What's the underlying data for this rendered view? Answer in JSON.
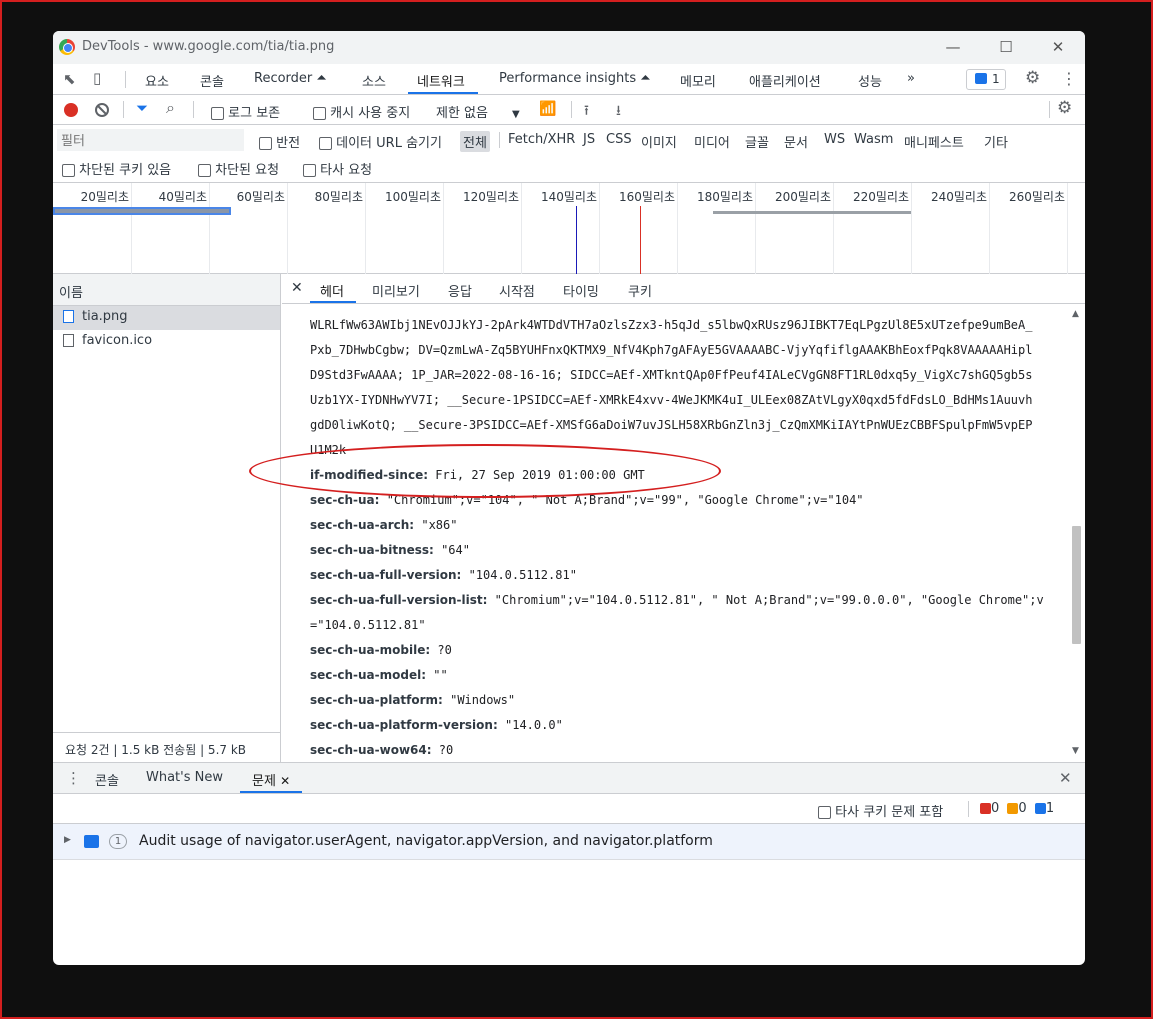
{
  "window": {
    "title": "DevTools - www.google.com/tia/tia.png"
  },
  "main_tabs": [
    {
      "label": "요소"
    },
    {
      "label": "콘솔"
    },
    {
      "label": "Recorder ⏶"
    },
    {
      "label": "소스"
    },
    {
      "label": "네트워크"
    },
    {
      "label": "Performance insights ⏶"
    },
    {
      "label": "메모리"
    },
    {
      "label": "애플리케이션"
    },
    {
      "label": "성능"
    },
    {
      "label": "»"
    }
  ],
  "issues_counter": "1",
  "toolbar": {
    "preserve_log": "로그 보존",
    "disable_cache": "캐시 사용 중지",
    "throttling": "제한 없음"
  },
  "filter": {
    "placeholder": "필터",
    "invert": "반전",
    "hide_data_urls": "데이터 URL 숨기기",
    "types": [
      "전체",
      "Fetch/XHR",
      "JS",
      "CSS",
      "이미지",
      "미디어",
      "글꼴",
      "문서",
      "WS",
      "Wasm",
      "매니페스트",
      "기타"
    ],
    "blocked_cookies": "차단된 쿠키 있음",
    "blocked_requests": "차단된 요청",
    "third_party": "타사 요청"
  },
  "timeline": {
    "labels": [
      "20밀리초",
      "40밀리초",
      "60밀리초",
      "80밀리초",
      "100밀리초",
      "120밀리초",
      "140밀리초",
      "160밀리초",
      "180밀리초",
      "200밀리초",
      "220밀리초",
      "240밀리초",
      "260밀리초"
    ]
  },
  "request_list": {
    "header": "이름",
    "rows": [
      {
        "name": "tia.png"
      },
      {
        "name": "favicon.ico"
      }
    ],
    "status": "요청 2건  |  1.5 kB 전송됨  |  5.7 kB"
  },
  "detail_tabs": [
    "헤더",
    "미리보기",
    "응답",
    "시작점",
    "타이밍",
    "쿠키"
  ],
  "headers": {
    "cookie_lines": [
      "WLRLfWw63AWIbj1NEvOJJkYJ-2pArk4WTDdVTH7aOzlsZzx3-h5qJd_s5lbwQxRUsz96JIBKT7EqLPgzUl8E5xUTzefpe9umBeA_",
      "Pxb_7DHwbCgbw; DV=QzmLwA-Zq5BYUHFnxQKTMX9_NfV4Kph7gAFAyE5GVAAAABC-VjyYqfiflgAAAKBhEoxfPqk8VAAAAAHipl",
      "D9Std3FwAAAA; 1P_JAR=2022-08-16-16; SIDCC=AEf-XMTkntQAp0FfPeuf4IALeCVgGN8FT1RL0dxq5y_VigXc7shGQ5gb5s",
      "Uzb1YX-IYDNHwYV7I; __Secure-1PSIDCC=AEf-XMRkE4xvv-4WeJKMK4uI_ULEex08ZAtVLgyX0qxd5fdFdsLO_BdHMs1Auuvh",
      "gdD0liwKotQ; __Secure-3PSIDCC=AEf-XMSfG6aDoiW7uvJSLH58XRbGnZln3j_CzQmXMKiIAYtPnWUEzCBBFSpulpFmW5vpEP",
      "U1M2k"
    ],
    "items": [
      {
        "name": "if-modified-since:",
        "value": "Fri, 27 Sep 2019 01:00:00 GMT"
      },
      {
        "name": "sec-ch-ua:",
        "value": "\"Chromium\";v=\"104\", \" Not A;Brand\";v=\"99\", \"Google Chrome\";v=\"104\""
      },
      {
        "name": "sec-ch-ua-arch:",
        "value": "\"x86\""
      },
      {
        "name": "sec-ch-ua-bitness:",
        "value": "\"64\""
      },
      {
        "name": "sec-ch-ua-full-version:",
        "value": "\"104.0.5112.81\""
      },
      {
        "name": "sec-ch-ua-full-version-list:",
        "value": "\"Chromium\";v=\"104.0.5112.81\", \" Not A;Brand\";v=\"99.0.0.0\", \"Google Chrome\";v"
      },
      {
        "name": "",
        "value": "=\"104.0.5112.81\""
      },
      {
        "name": "sec-ch-ua-mobile:",
        "value": "?0"
      },
      {
        "name": "sec-ch-ua-model:",
        "value": "\"\""
      },
      {
        "name": "sec-ch-ua-platform:",
        "value": "\"Windows\""
      },
      {
        "name": "sec-ch-ua-platform-version:",
        "value": "\"14.0.0\""
      },
      {
        "name": "sec-ch-ua-wow64:",
        "value": "?0"
      }
    ]
  },
  "drawer": {
    "tabs": [
      "콘솔",
      "What's New",
      "문제"
    ],
    "third_party_issues": "타사 쿠키 문제 포함",
    "counts": {
      "errors": "0",
      "warnings": "0",
      "info": "1"
    },
    "issue": {
      "count": "1",
      "text": "Audit usage of navigator.userAgent, navigator.appVersion, and navigator.platform"
    }
  },
  "colors": {
    "accent": "#1a73e8",
    "annotation": "#d41f1f",
    "record": "#d93025"
  }
}
